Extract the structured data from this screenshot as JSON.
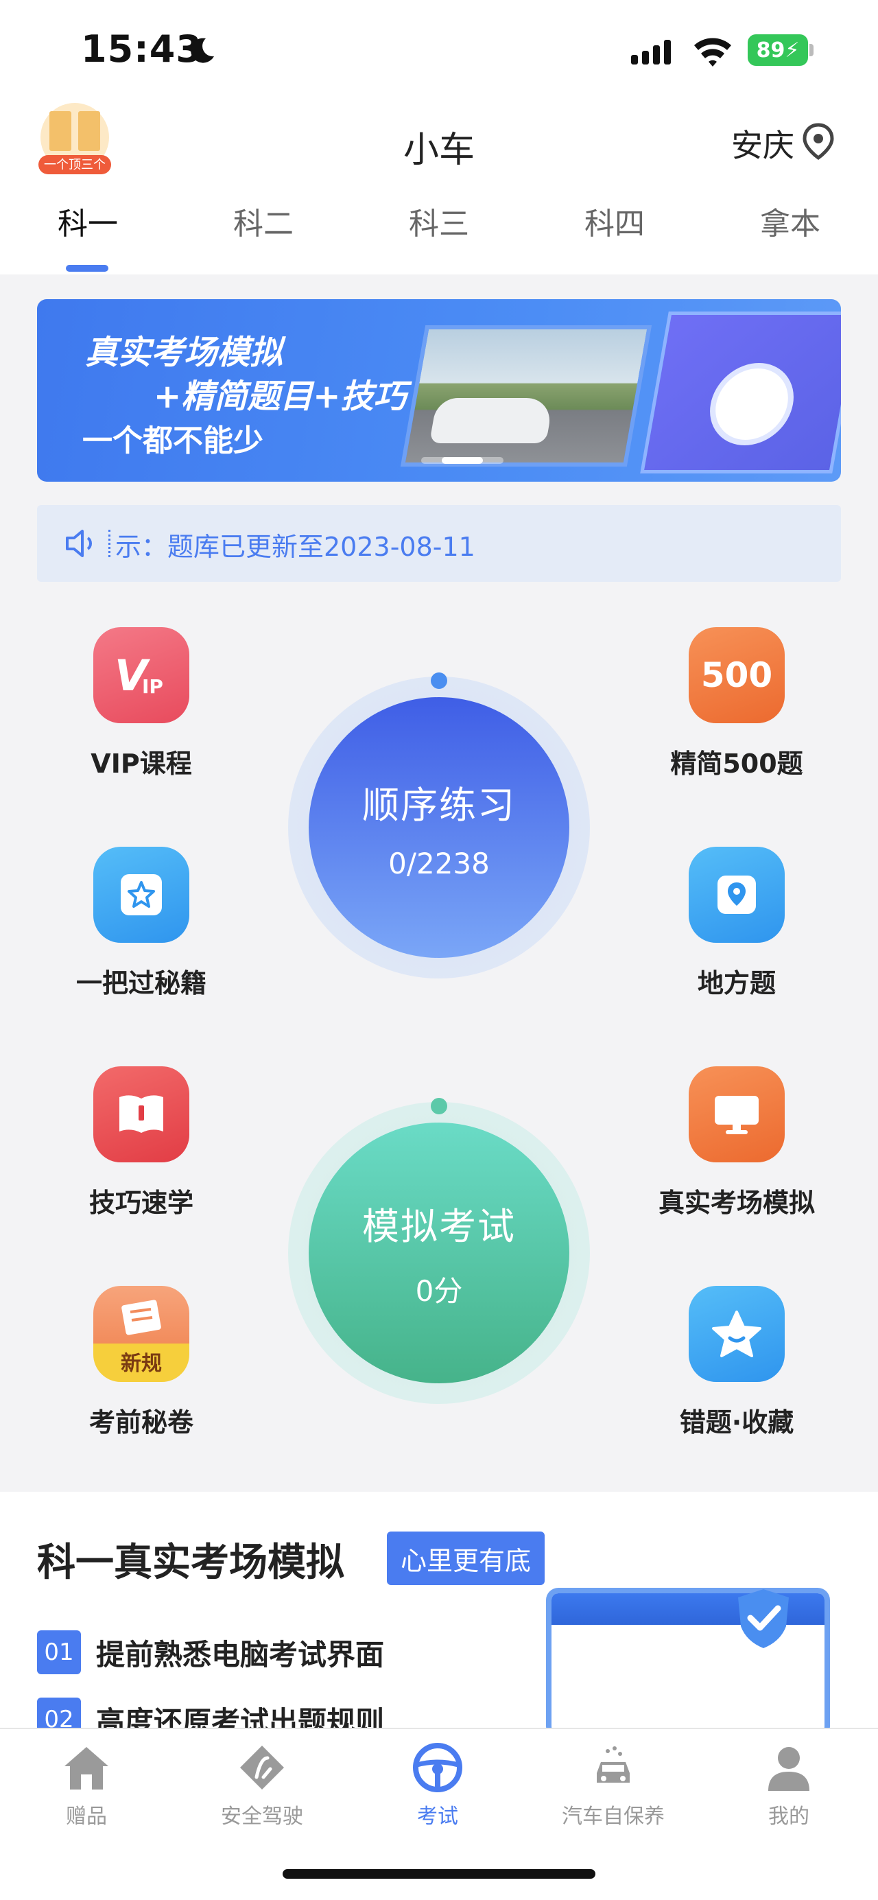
{
  "status_bar": {
    "time": "15:43",
    "battery": "89"
  },
  "header": {
    "logo_text": "一个顶三个",
    "title": "小车",
    "city": "安庆",
    "tabs": [
      {
        "label": "科一",
        "active": true
      },
      {
        "label": "科二",
        "active": false
      },
      {
        "label": "科三",
        "active": false
      },
      {
        "label": "科四",
        "active": false
      },
      {
        "label": "拿本",
        "active": false
      }
    ]
  },
  "banner": {
    "line1": "真实考场模拟",
    "line2": "+精简题目+技巧",
    "line3": "一个都不能少"
  },
  "notice": {
    "text": "示：题库已更新至2023-08-11"
  },
  "features": {
    "vip": {
      "label": "VIP课程",
      "icon_text": "VIP",
      "color": "#ef5b6b"
    },
    "secret": {
      "label": "一把过秘籍",
      "color": "#3fa8f6"
    },
    "tips": {
      "label": "技巧速学",
      "color": "#ec4f52"
    },
    "pre_exam": {
      "label": "考前秘卷",
      "badge": "新规",
      "color": "#f4a23a"
    },
    "simple500": {
      "label": "精简500题",
      "icon_text": "500",
      "color": "#f07a3a"
    },
    "local": {
      "label": "地方题",
      "color": "#3fa8f6"
    },
    "real_exam": {
      "label": "真实考场模拟",
      "color": "#f07a3a"
    },
    "mistakes": {
      "label": "错题·收藏",
      "color": "#3fa8f6"
    }
  },
  "practice": {
    "title": "顺序练习",
    "progress": "0/2238",
    "done": 0,
    "total": 2238
  },
  "mock_exam": {
    "title": "模拟考试",
    "score": "0分"
  },
  "section": {
    "title": "科一真实考场模拟",
    "badge": "心里更有底",
    "items": [
      {
        "num": "01",
        "text": "提前熟悉电脑考试界面"
      },
      {
        "num": "02",
        "text": "高度还原考试出题规则"
      }
    ]
  },
  "bottom_nav": [
    {
      "label": "赠品",
      "icon": "home-icon",
      "active": false
    },
    {
      "label": "安全驾驶",
      "icon": "safe-drive-icon",
      "active": false
    },
    {
      "label": "考试",
      "icon": "steering-wheel-icon",
      "active": true
    },
    {
      "label": "汽车自保养",
      "icon": "car-wash-icon",
      "active": false
    },
    {
      "label": "我的",
      "icon": "profile-icon",
      "active": false
    }
  ],
  "colors": {
    "accent": "#4a7cf0",
    "practice_gradient": [
      "#3f5ee6",
      "#7aa6f7"
    ],
    "exam_gradient": [
      "#6adbc6",
      "#46b38a"
    ]
  }
}
